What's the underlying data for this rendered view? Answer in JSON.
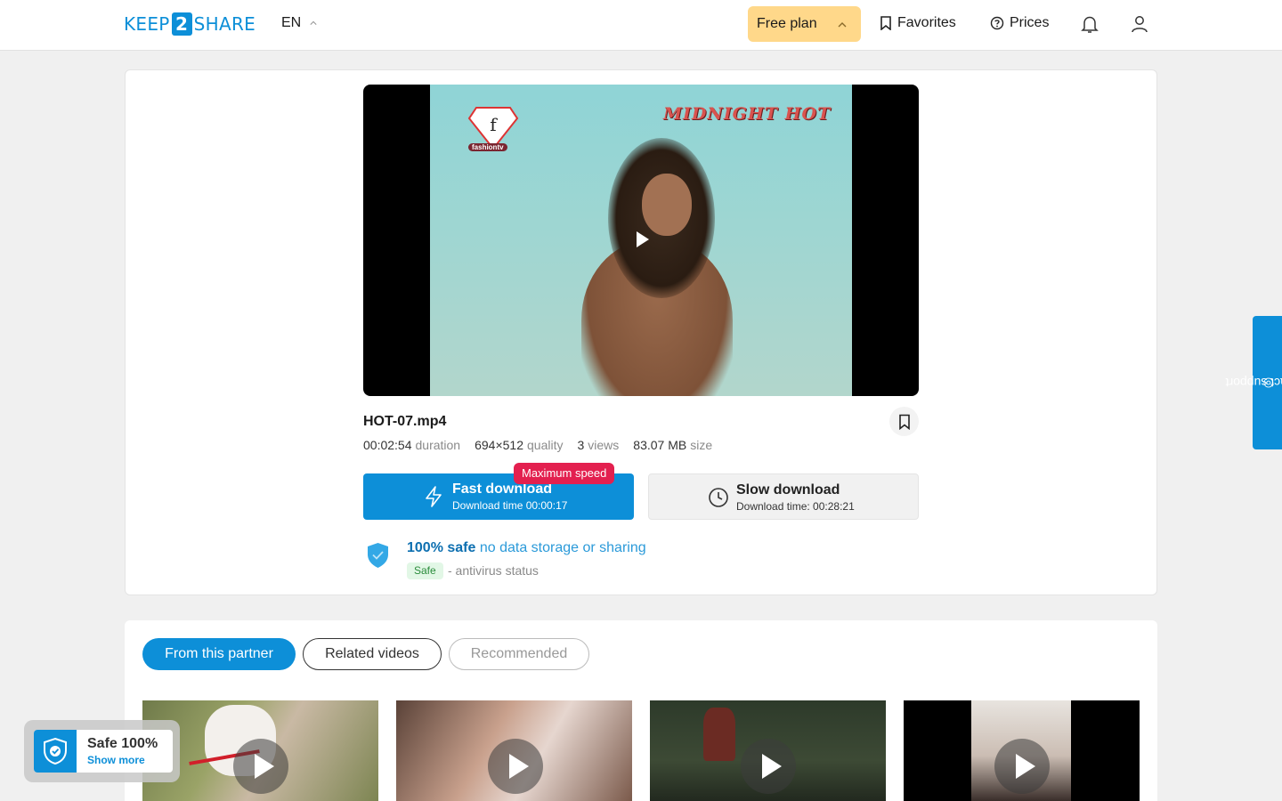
{
  "header": {
    "logo": {
      "left": "KEEP",
      "mid": "2",
      "right": "SHARE"
    },
    "language": "EN",
    "plan_label": "Free plan",
    "favorites_label": "Favorites",
    "prices_label": "Prices"
  },
  "video": {
    "filename": "HOT-07.mp4",
    "overlay_brand": "MIDNIGHT HOT",
    "overlay_channel": "fashiontv",
    "overlay_logo_letter": "f",
    "duration": "00:02:54",
    "duration_label": "duration",
    "quality": "694×512",
    "quality_label": "quality",
    "views": "3",
    "views_label": "views",
    "size": "83.07 MB",
    "size_label": "size"
  },
  "download": {
    "fast_label": "Fast download",
    "fast_time": "Download time 00:00:17",
    "speed_badge": "Maximum speed",
    "slow_label": "Slow download",
    "slow_time": "Download time: 00:28:21"
  },
  "safety": {
    "headline": "100% safe",
    "subline": "no data storage or sharing",
    "badge": "Safe",
    "status_text": "- antivirus status"
  },
  "tabs": [
    {
      "label": "From this partner"
    },
    {
      "label": "Related videos"
    },
    {
      "label": "Recommended"
    }
  ],
  "safe_widget": {
    "title": "Safe 100%",
    "link": "Show more"
  },
  "support": {
    "label": "contact support"
  },
  "colors": {
    "accent": "#0d8fd8",
    "plan_bg": "#ffd88a",
    "badge_red": "#e3204f"
  }
}
